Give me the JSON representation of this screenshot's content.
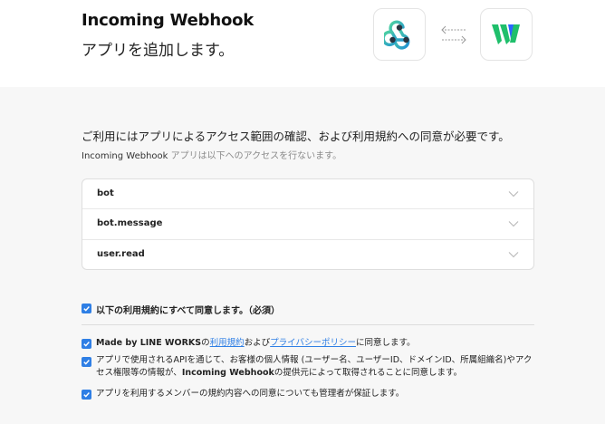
{
  "header": {
    "app_name": "Incoming Webhook",
    "subtitle": "アプリを追加します。"
  },
  "icons": {
    "webhook": "webhook-icon",
    "line_works": "line-works-icon",
    "exchange": "exchange-arrows-icon"
  },
  "consent": {
    "title": "ご利用にはアプリによるアクセス範囲の確認、および利用規約への同意が必要です。",
    "sub_app": "Incoming Webhook",
    "sub_text": " アプリは以下へのアクセスを行ないます。"
  },
  "scopes": [
    {
      "label": "bot"
    },
    {
      "label": "bot.message"
    },
    {
      "label": "user.read"
    }
  ],
  "agree_all": {
    "label": "以下の利用規約にすべて同意します。（必須）",
    "checked": true
  },
  "terms": {
    "t1_brand": "Made by LINE WORKS",
    "t1_no": "の",
    "t1_link1": "利用規約",
    "t1_and": "および",
    "t1_link2": "プライバシーポリシー",
    "t1_end": "に同意します。",
    "t2_part1": "アプリで使用されるAPIを通じて、お客様の個人情報 (ユーザー名、ユーザーID、ドメインID、所属組織名)やアクセス権限等の情報が、",
    "t2_app": "Incoming Webhook",
    "t2_part2": "の提供元によって取得されることに同意します。",
    "t3": "アプリを利用するメンバーの規約内容への同意についても管理者が保証します。"
  },
  "colors": {
    "accent": "#2f7fe5",
    "webhook_green": "#3cc08a",
    "works_green": "#1fbf6b",
    "works_blue": "#2a66ff"
  }
}
